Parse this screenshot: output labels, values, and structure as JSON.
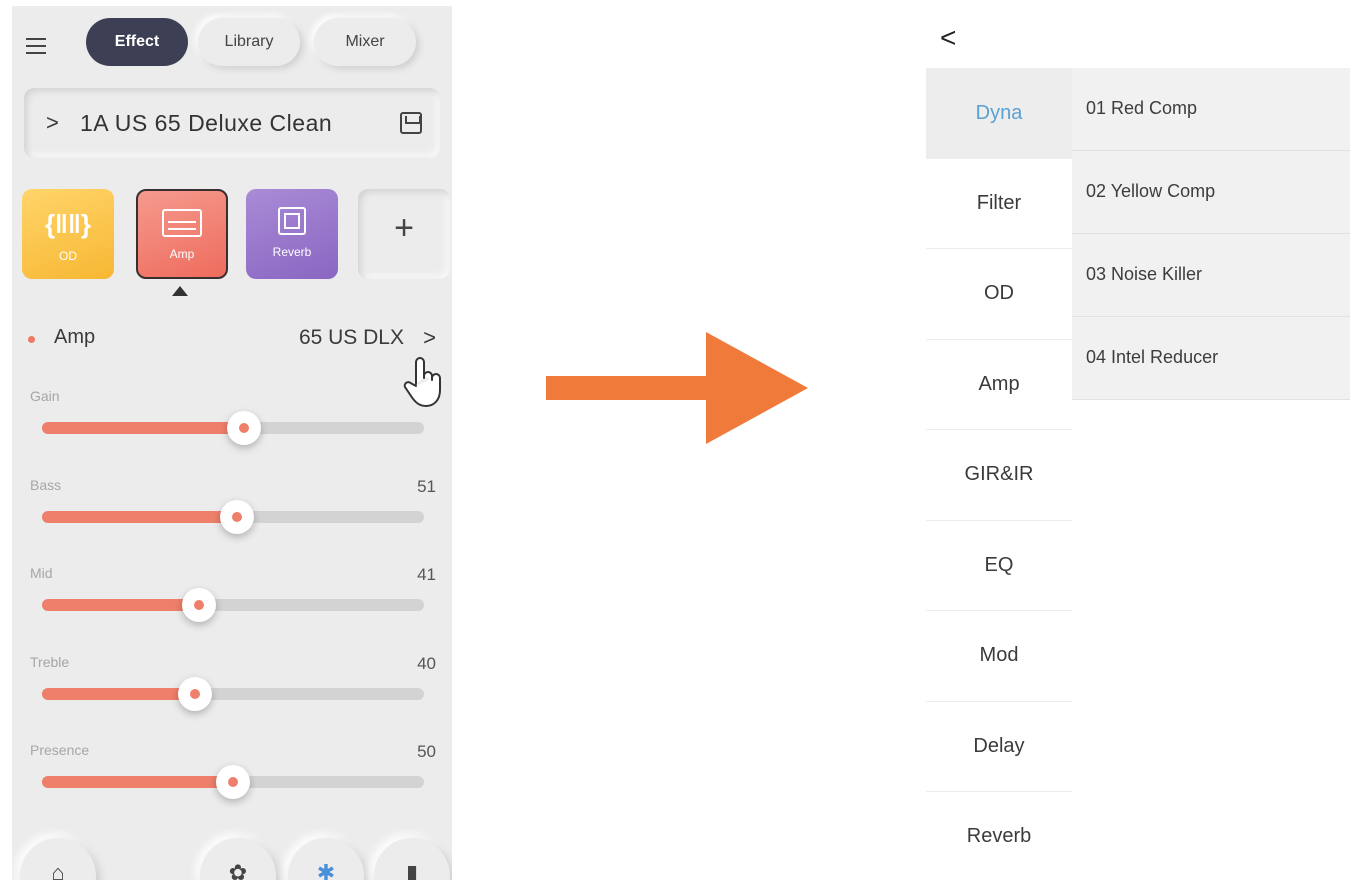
{
  "left_screen": {
    "tabs": [
      {
        "label": "Effect"
      },
      {
        "label": "Library"
      },
      {
        "label": "Mixer"
      }
    ],
    "preset": {
      "chevron": ">",
      "name": "1A  US 65 Deluxe Clean"
    },
    "effect_blocks": [
      {
        "label": "OD",
        "glyph": "{‖‖}",
        "color": "#f7b733"
      },
      {
        "label": "Amp",
        "color": "#ee6c5d",
        "selected": true
      },
      {
        "label": "Reverb",
        "color": "#8a66c2"
      },
      {
        "label": "",
        "glyph": "+"
      }
    ],
    "section": {
      "title": "Amp",
      "model": "65 US DLX",
      "chevron": ">"
    },
    "params": [
      {
        "label": "Gain",
        "value": "",
        "level": 53
      },
      {
        "label": "Bass",
        "value": "51",
        "level": 51
      },
      {
        "label": "Mid",
        "value": "41",
        "level": 41
      },
      {
        "label": "Treble",
        "value": "40",
        "level": 40
      },
      {
        "label": "Presence",
        "value": "50",
        "level": 50
      }
    ],
    "bottom_icons": [
      "home-icon",
      "wifi-icon",
      "bluetooth-icon",
      "battery-icon"
    ],
    "accent_color": "#ee7f6b"
  },
  "arrow_color": "#f07a3a",
  "right_screen": {
    "back": "<",
    "categories": [
      "Dyna",
      "Filter",
      "OD",
      "Amp",
      "GIR&IR",
      "EQ",
      "Mod",
      "Delay",
      "Reverb"
    ],
    "active_category": "Dyna",
    "active_color": "#5aa0d2",
    "presets": [
      "01  Red Comp",
      "02  Yellow Comp",
      "03  Noise Killer",
      "04  Intel Reducer"
    ]
  }
}
